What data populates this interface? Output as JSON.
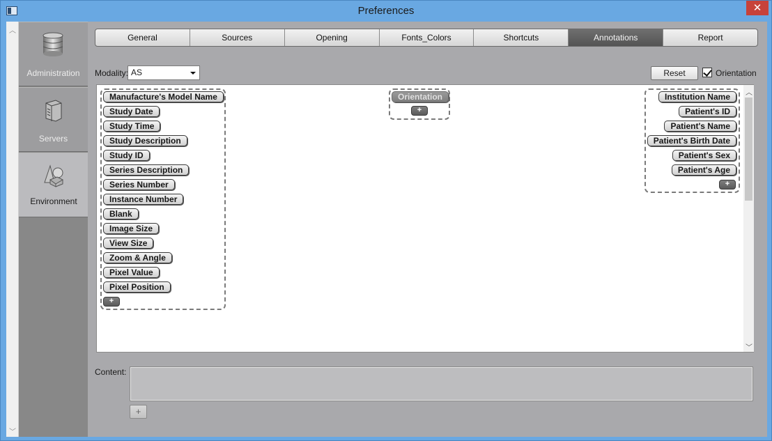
{
  "window": {
    "title": "Preferences",
    "close_glyph": "✕"
  },
  "nav": {
    "items": [
      {
        "label": "Administration",
        "icon": "database-icon",
        "active": false
      },
      {
        "label": "Servers",
        "icon": "server-icon",
        "active": false
      },
      {
        "label": "Environment",
        "icon": "shapes-icon",
        "active": true
      }
    ]
  },
  "tabs": [
    {
      "label": "General",
      "active": false
    },
    {
      "label": "Sources",
      "active": false
    },
    {
      "label": "Opening",
      "active": false
    },
    {
      "label": "Fonts_Colors",
      "active": false
    },
    {
      "label": "Shortcuts",
      "active": false
    },
    {
      "label": "Annotations",
      "active": true
    },
    {
      "label": "Report",
      "active": false
    }
  ],
  "toolbar": {
    "modality_label": "Modality:",
    "modality_value": "AS",
    "reset_label": "Reset",
    "orientation_label": "Orientation",
    "orientation_checked": true
  },
  "annotations": {
    "left": [
      "Manufacture's Model Name",
      "Study Date",
      "Study Time",
      "Study Description",
      "Study ID",
      "Series Description",
      "Series Number",
      "Instance Number",
      "Blank",
      "Image Size",
      "View Size",
      "Zoom & Angle",
      "Pixel Value",
      "Pixel Position"
    ],
    "center": [
      "Orientation"
    ],
    "right": [
      "Institution Name",
      "Patient's ID",
      "Patient's Name",
      "Patient's Birth Date",
      "Patient's Sex",
      "Patient's Age"
    ],
    "add_glyph": "+"
  },
  "content": {
    "label": "Content:",
    "value": "",
    "add_glyph": "+"
  },
  "colors": {
    "active_tab": "#5e5e5e",
    "canvas": "#ffffff",
    "close": "#c7423a"
  }
}
